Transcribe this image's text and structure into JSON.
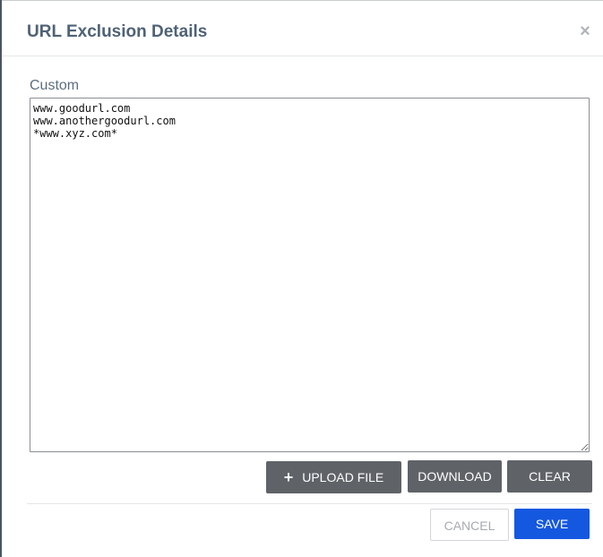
{
  "dialog": {
    "title": "URL Exclusion Details",
    "close_icon": "×"
  },
  "custom_field": {
    "label": "Custom",
    "value": "www.goodurl.com\nwww.anothergoodurl.com\n*www.xyz.com*"
  },
  "buttons": {
    "upload_icon": "+",
    "upload_label": "UPLOAD FILE",
    "download_label": "DOWNLOAD",
    "clear_label": "CLEAR",
    "cancel_label": "CANCEL",
    "save_label": "SAVE"
  },
  "colors": {
    "title": "#4f6275",
    "dark_button": "#5f6368",
    "primary_button": "#1458e0"
  }
}
